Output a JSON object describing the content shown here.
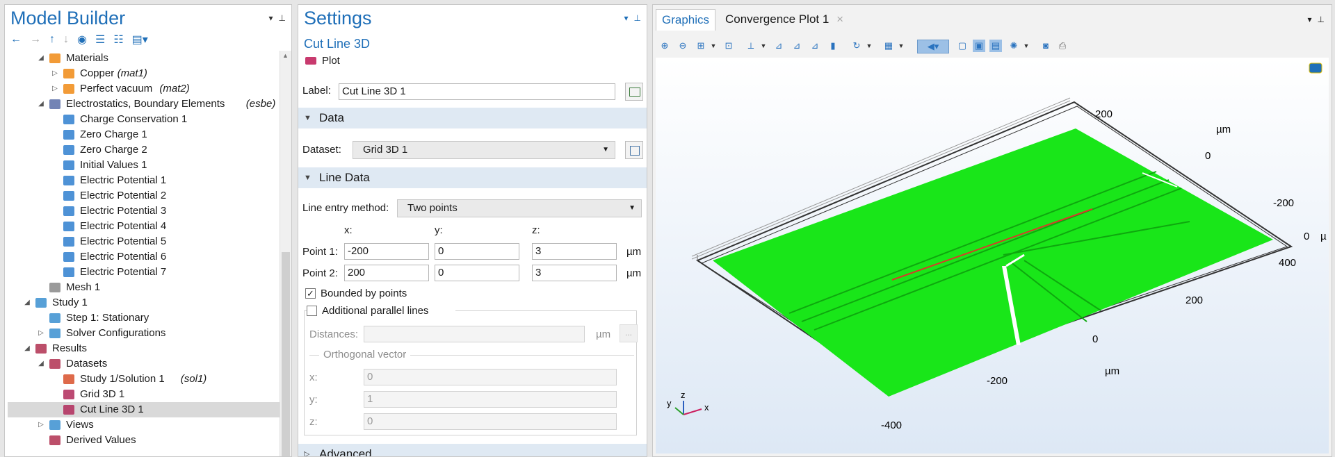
{
  "model_builder": {
    "title": "Model Builder",
    "tree": [
      {
        "label": "Materials",
        "tag": "",
        "level": 2,
        "expander": "open",
        "icon": "materials-icon"
      },
      {
        "label": "Copper",
        "tag": "(mat1)",
        "level": 3,
        "expander": "closed",
        "icon": "material-icon"
      },
      {
        "label": "Perfect vacuum",
        "tag": "(mat2)",
        "level": 3,
        "expander": "closed",
        "icon": "material-icon"
      },
      {
        "label": "Electrostatics, Boundary Elements",
        "tag": "(esbe)",
        "level": 2,
        "expander": "open",
        "icon": "physics-icon"
      },
      {
        "label": "Charge Conservation 1",
        "tag": "",
        "level": 3,
        "expander": "",
        "icon": "domain-feature-icon"
      },
      {
        "label": "Zero Charge 1",
        "tag": "",
        "level": 3,
        "expander": "",
        "icon": "boundary-default-icon"
      },
      {
        "label": "Zero Charge 2",
        "tag": "",
        "level": 3,
        "expander": "",
        "icon": "boundary-feature-icon"
      },
      {
        "label": "Initial Values 1",
        "tag": "",
        "level": 3,
        "expander": "",
        "icon": "initial-values-icon"
      },
      {
        "label": "Electric Potential 1",
        "tag": "",
        "level": 3,
        "expander": "",
        "icon": "boundary-feature-icon"
      },
      {
        "label": "Electric Potential 2",
        "tag": "",
        "level": 3,
        "expander": "",
        "icon": "boundary-feature-icon"
      },
      {
        "label": "Electric Potential 3",
        "tag": "",
        "level": 3,
        "expander": "",
        "icon": "boundary-feature-icon"
      },
      {
        "label": "Electric Potential 4",
        "tag": "",
        "level": 3,
        "expander": "",
        "icon": "boundary-feature-icon"
      },
      {
        "label": "Electric Potential 5",
        "tag": "",
        "level": 3,
        "expander": "",
        "icon": "boundary-feature-icon"
      },
      {
        "label": "Electric Potential 6",
        "tag": "",
        "level": 3,
        "expander": "",
        "icon": "boundary-feature-icon"
      },
      {
        "label": "Electric Potential 7",
        "tag": "",
        "level": 3,
        "expander": "",
        "icon": "boundary-feature-icon"
      },
      {
        "label": "Mesh 1",
        "tag": "",
        "level": 2,
        "expander": "",
        "icon": "mesh-icon"
      },
      {
        "label": "Study 1",
        "tag": "",
        "level": 1,
        "expander": "open",
        "icon": "study-icon"
      },
      {
        "label": "Step 1: Stationary",
        "tag": "",
        "level": 2,
        "expander": "",
        "icon": "step-icon"
      },
      {
        "label": "Solver Configurations",
        "tag": "",
        "level": 2,
        "expander": "closed",
        "icon": "solver-icon"
      },
      {
        "label": "Results",
        "tag": "",
        "level": 1,
        "expander": "open",
        "icon": "results-icon"
      },
      {
        "label": "Datasets",
        "tag": "",
        "level": 2,
        "expander": "open",
        "icon": "datasets-icon"
      },
      {
        "label": "Study 1/Solution 1",
        "tag": "(sol1)",
        "level": 3,
        "expander": "",
        "icon": "solution-icon"
      },
      {
        "label": "Grid 3D 1",
        "tag": "",
        "level": 3,
        "expander": "",
        "icon": "grid-icon"
      },
      {
        "label": "Cut Line 3D 1",
        "tag": "",
        "level": 3,
        "expander": "",
        "icon": "cut-line-icon",
        "selected": true
      },
      {
        "label": "Views",
        "tag": "",
        "level": 2,
        "expander": "closed",
        "icon": "views-icon"
      },
      {
        "label": "Derived Values",
        "tag": "",
        "level": 2,
        "expander": "",
        "icon": "derived-values-icon"
      }
    ]
  },
  "settings": {
    "title": "Settings",
    "subtitle": "Cut Line 3D",
    "plot_label": "Plot",
    "label_caption": "Label:",
    "label_value": "Cut Line 3D 1",
    "data_section": "Data",
    "dataset_caption": "Dataset:",
    "dataset_value": "Grid 3D 1",
    "line_data_section": "Line Data",
    "entry_caption": "Line entry method:",
    "entry_value": "Two points",
    "x_head": "x:",
    "y_head": "y:",
    "z_head": "z:",
    "point1_caption": "Point 1:",
    "point1": {
      "x": "-200",
      "y": "0",
      "z": "3"
    },
    "point2_caption": "Point 2:",
    "point2": {
      "x": "200",
      "y": "0",
      "z": "3"
    },
    "unit": "µm",
    "bounded_label": "Bounded by points",
    "parallel_label": "Additional parallel lines",
    "distances_caption": "Distances:",
    "distances_unit": "µm",
    "browse_label": "...",
    "orth_caption": "Orthogonal vector",
    "orth_x_caption": "x:",
    "orth_y_caption": "y:",
    "orth_z_caption": "z:",
    "orth": {
      "x": "0",
      "y": "1",
      "z": "0"
    },
    "advanced_section": "Advanced"
  },
  "graphics": {
    "tabs": [
      {
        "label": "Graphics",
        "active": true
      },
      {
        "label": "Convergence Plot 1",
        "active": false
      }
    ],
    "axis_labels": {
      "top_200": "200",
      "top_unit": "µm",
      "top_0": "0",
      "top_m200": "-200",
      "top_right_0": "0",
      "top_right_mu": "µ",
      "bot_400": "400",
      "bot_200": "200",
      "bot_0": "0",
      "bot_unit": "µm",
      "bot_m200": "-200",
      "bot_m400": "-400"
    },
    "triad": {
      "x": "x",
      "y": "y",
      "z": "z"
    },
    "colors": {
      "plate": "#19e619",
      "cutline": "#d83a2a",
      "title": "#1f6fb8"
    }
  }
}
